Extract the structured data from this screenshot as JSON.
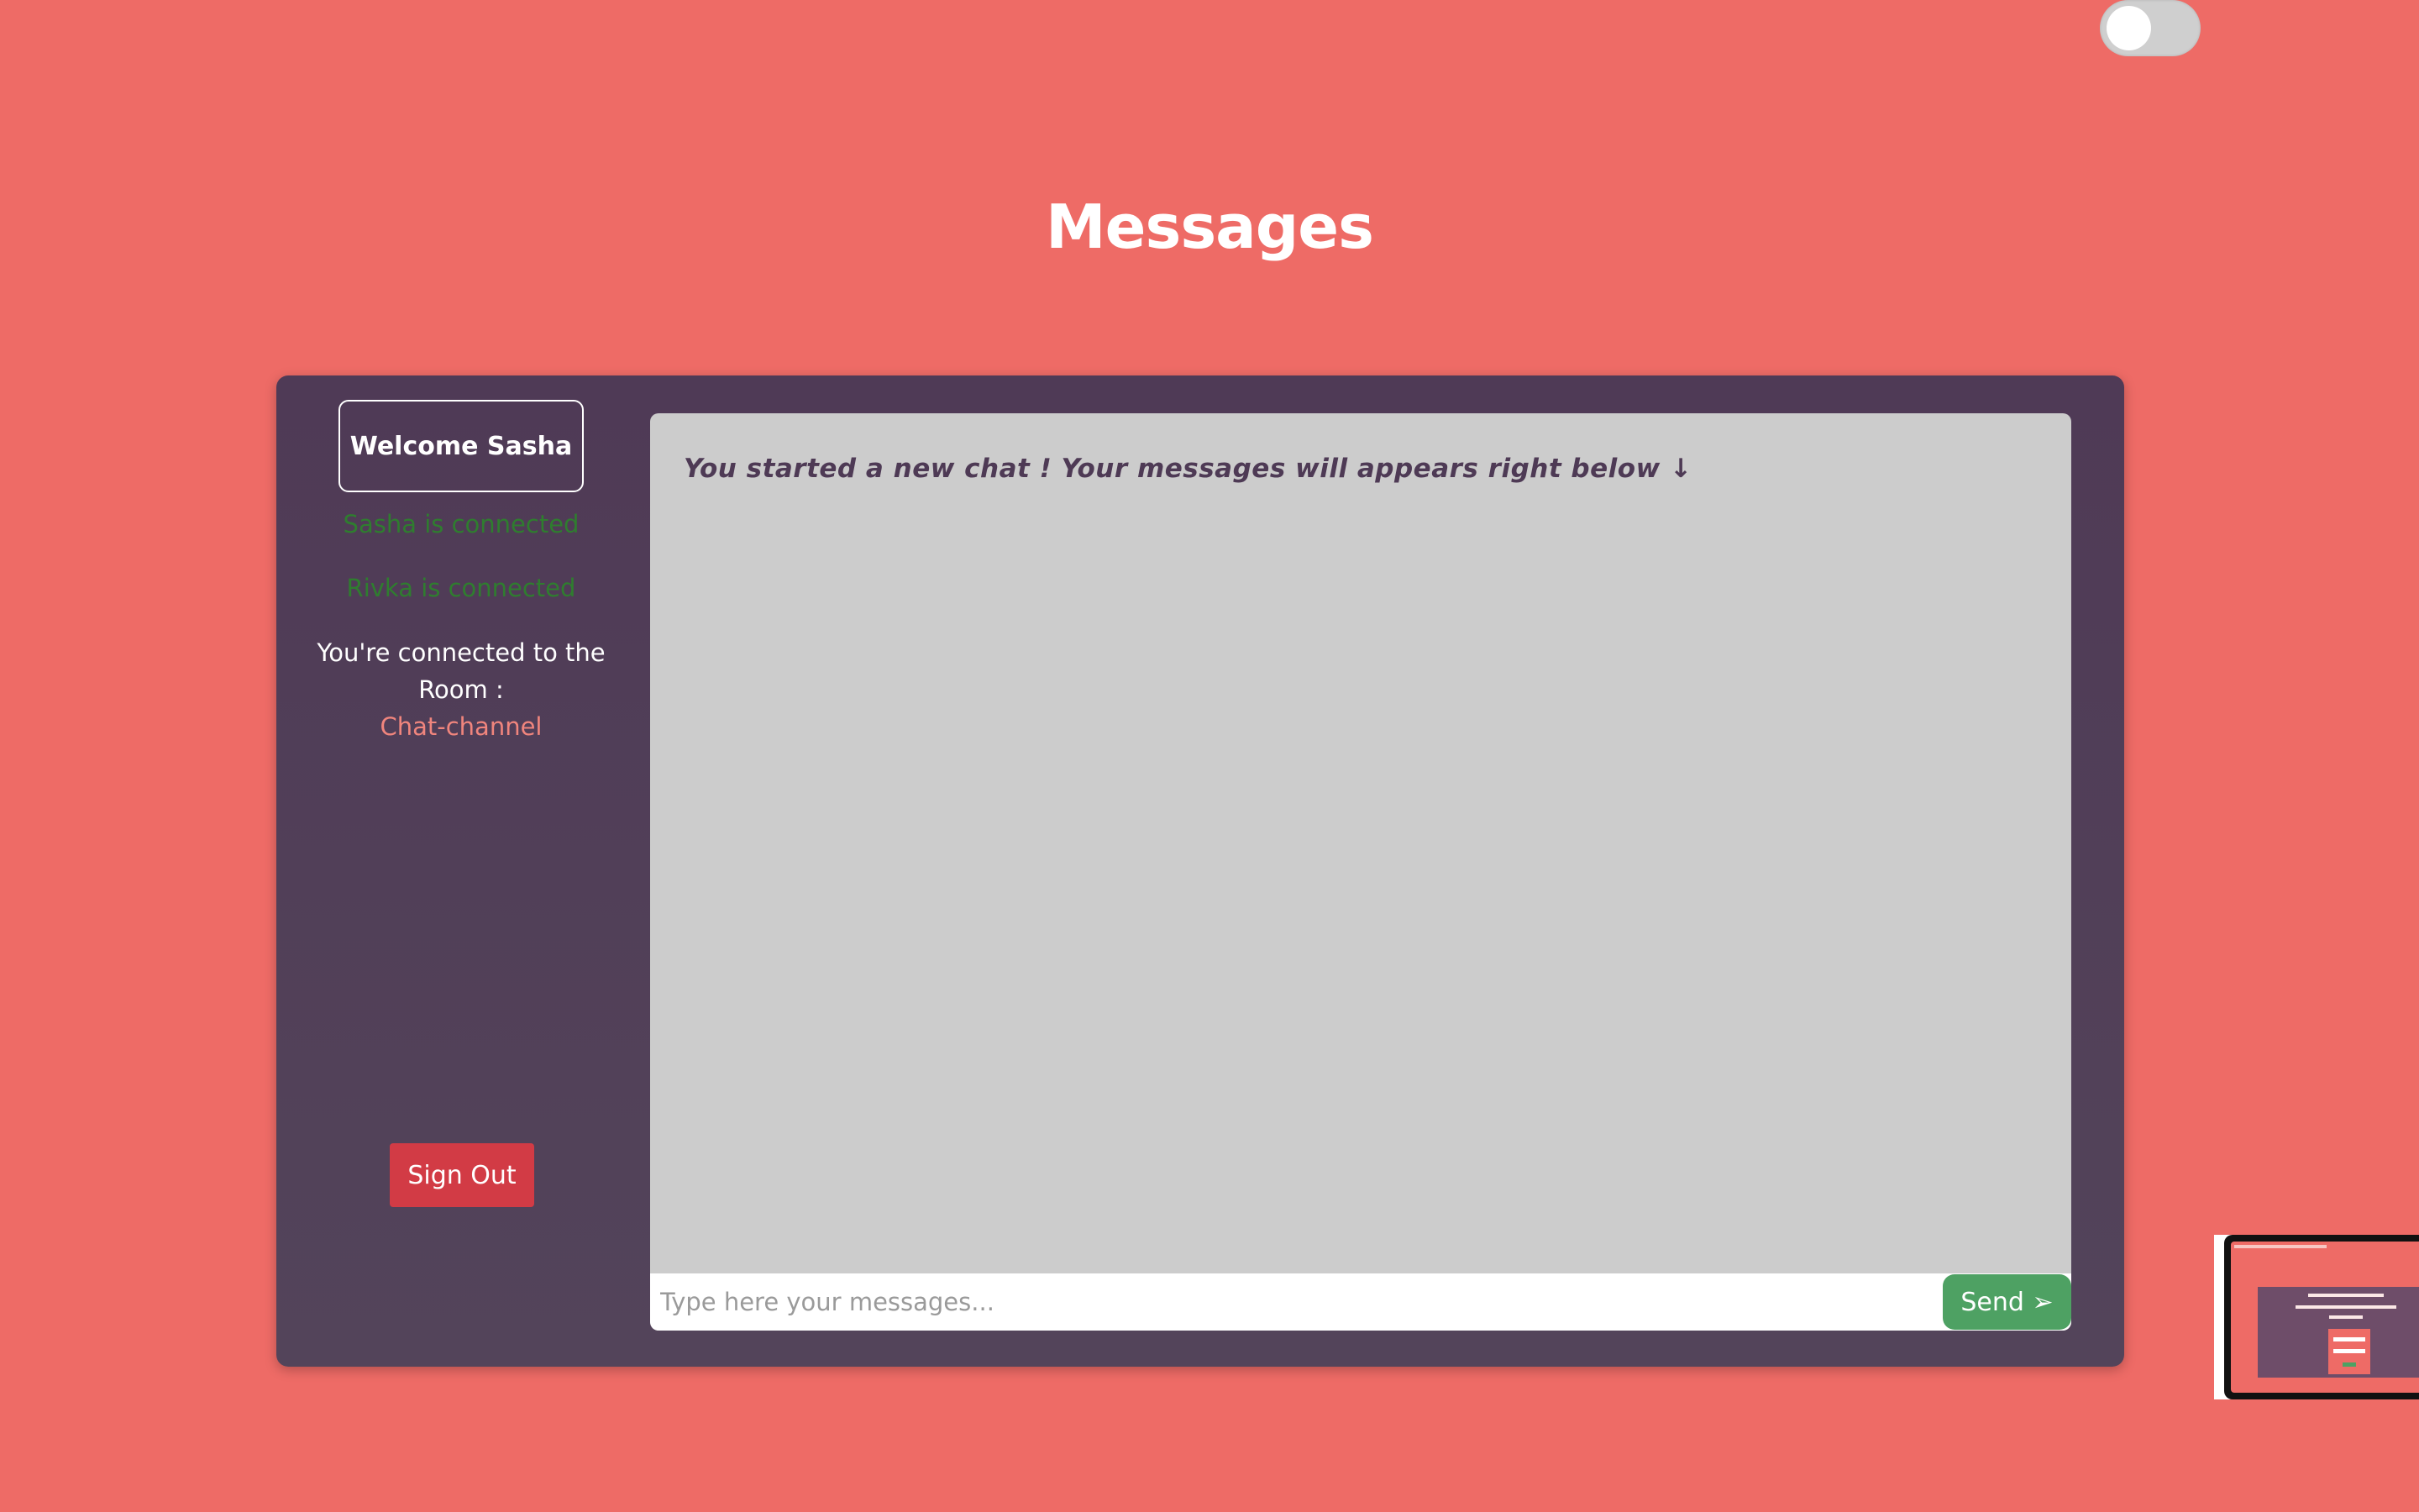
{
  "header": {
    "title": "Messages"
  },
  "sidebar": {
    "welcome": "Welcome Sasha",
    "statuses": [
      "Sasha is connected",
      "Rivka is connected"
    ],
    "room_label": "You're connected to the Room :",
    "room_name": "Chat-channel",
    "sign_out_label": "Sign Out"
  },
  "chat": {
    "intro_message": "You started a new chat ! Your messages will appears right below ↓",
    "input_placeholder": "Type here your messages...",
    "input_value": "",
    "send_label": "Send ➢"
  },
  "theme_toggle": {
    "state": "off"
  },
  "colors": {
    "background": "#ee6b66",
    "card": "#4f3a56",
    "status_green": "#2f7d2f",
    "room_accent": "#f0857d",
    "sign_out": "#d23b45",
    "send": "#4ea163",
    "panel": "#cccccc"
  }
}
